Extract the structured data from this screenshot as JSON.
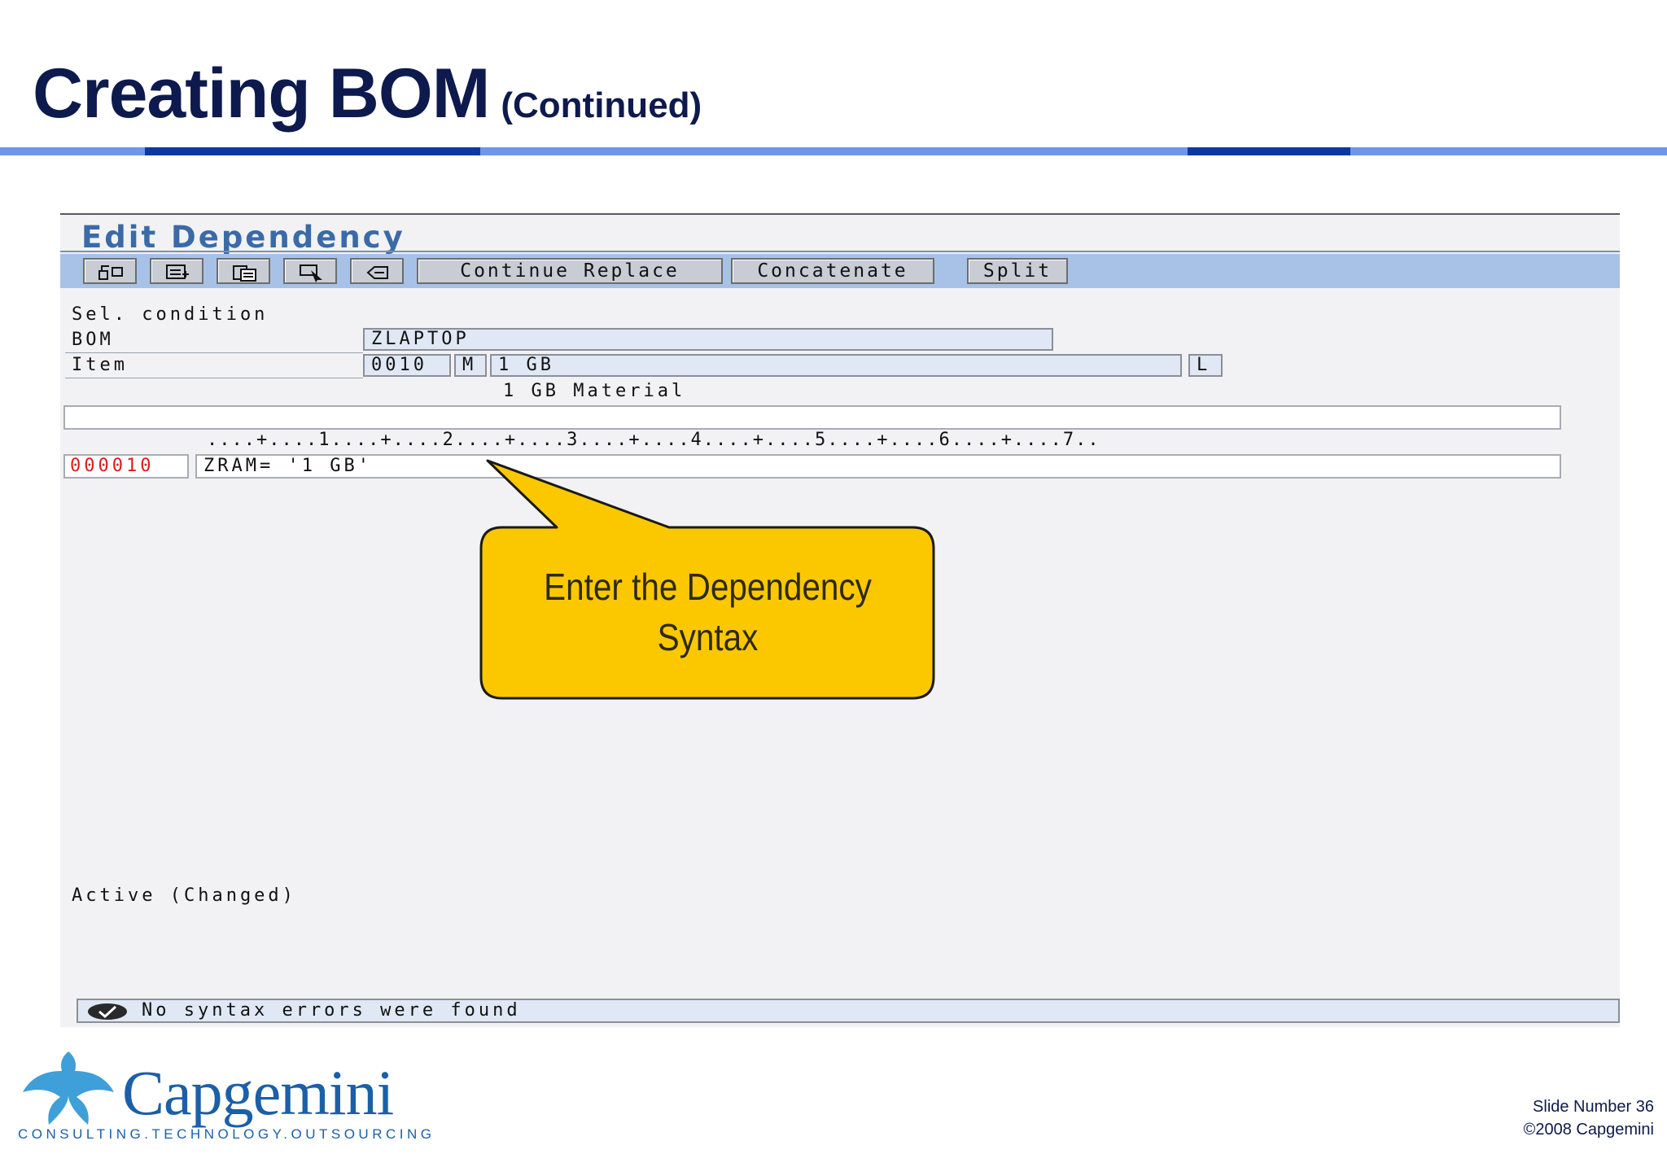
{
  "slide": {
    "title": "Creating BOM",
    "subtitle": "(Continued)",
    "slide_number": "Slide Number 36",
    "copyright": "©2008 Capgemini"
  },
  "logo": {
    "wordmark": "Capgemini",
    "tagline": "CONSULTING.TECHNOLOGY.OUTSOURCING"
  },
  "sap": {
    "screen_title": "Edit Dependency",
    "toolbar": {
      "icons": [
        "insert-line-icon",
        "select-block-icon",
        "paste-icon",
        "cursor-select-icon",
        "undo-icon"
      ],
      "continue_replace": "Continue Replace",
      "concatenate": "Concatenate",
      "split": "Split"
    },
    "header": {
      "sel_condition_label": "Sel. condition",
      "bom_label": "BOM",
      "bom_value": "ZLAPTOP",
      "item_label": "Item",
      "item_number": "0010",
      "item_category": "M",
      "item_component": "1  GB",
      "item_flag": "L",
      "item_description": "1 GB Material"
    },
    "editor": {
      "ruler": "....+....1....+....2....+....3....+....4....+....5....+....6....+....7..",
      "line_number": "000010",
      "code_line": "ZRAM=  '1  GB'"
    },
    "status_text": "Active  (Changed)",
    "message": "No syntax errors were found"
  },
  "callout": {
    "text_line1": "Enter the Dependency",
    "text_line2": "Syntax",
    "color": "#fbc800"
  },
  "colors": {
    "title": "#0d1a4d",
    "rule_light": "#6e98e6",
    "rule_dark": "#0a3a9c",
    "toolbar": "#a7c2e6",
    "line_number": "#e01a1a"
  }
}
